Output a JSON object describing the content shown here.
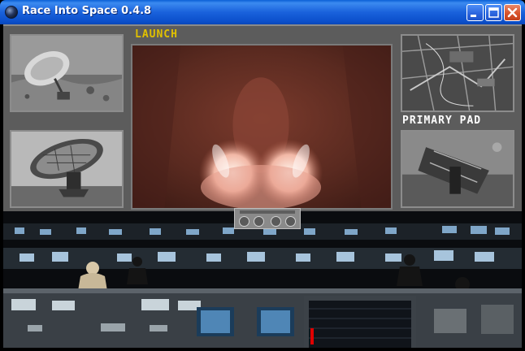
{
  "window": {
    "title": "Race Into Space 0.4.8",
    "buttons": [
      "minimize",
      "maximize",
      "close"
    ]
  },
  "screen": {
    "main_monitor_label": "LAUNCH",
    "side_monitor_label": "PRIMARY PAD",
    "colors": {
      "label_launch": "#e0c000",
      "label_pad": "#ffffff",
      "panel": "#5c5c5c"
    }
  },
  "monitors": {
    "top_left": "radar-dish-icon",
    "bottom_left": "antenna-dish-icon",
    "top_right": "launch-site-map-icon",
    "bottom_right": "launch-pad-icon",
    "main": "rocket-launch-icon"
  },
  "playback_controls": [
    "rewind-icon",
    "play-icon",
    "pause-icon",
    "stop-icon"
  ]
}
